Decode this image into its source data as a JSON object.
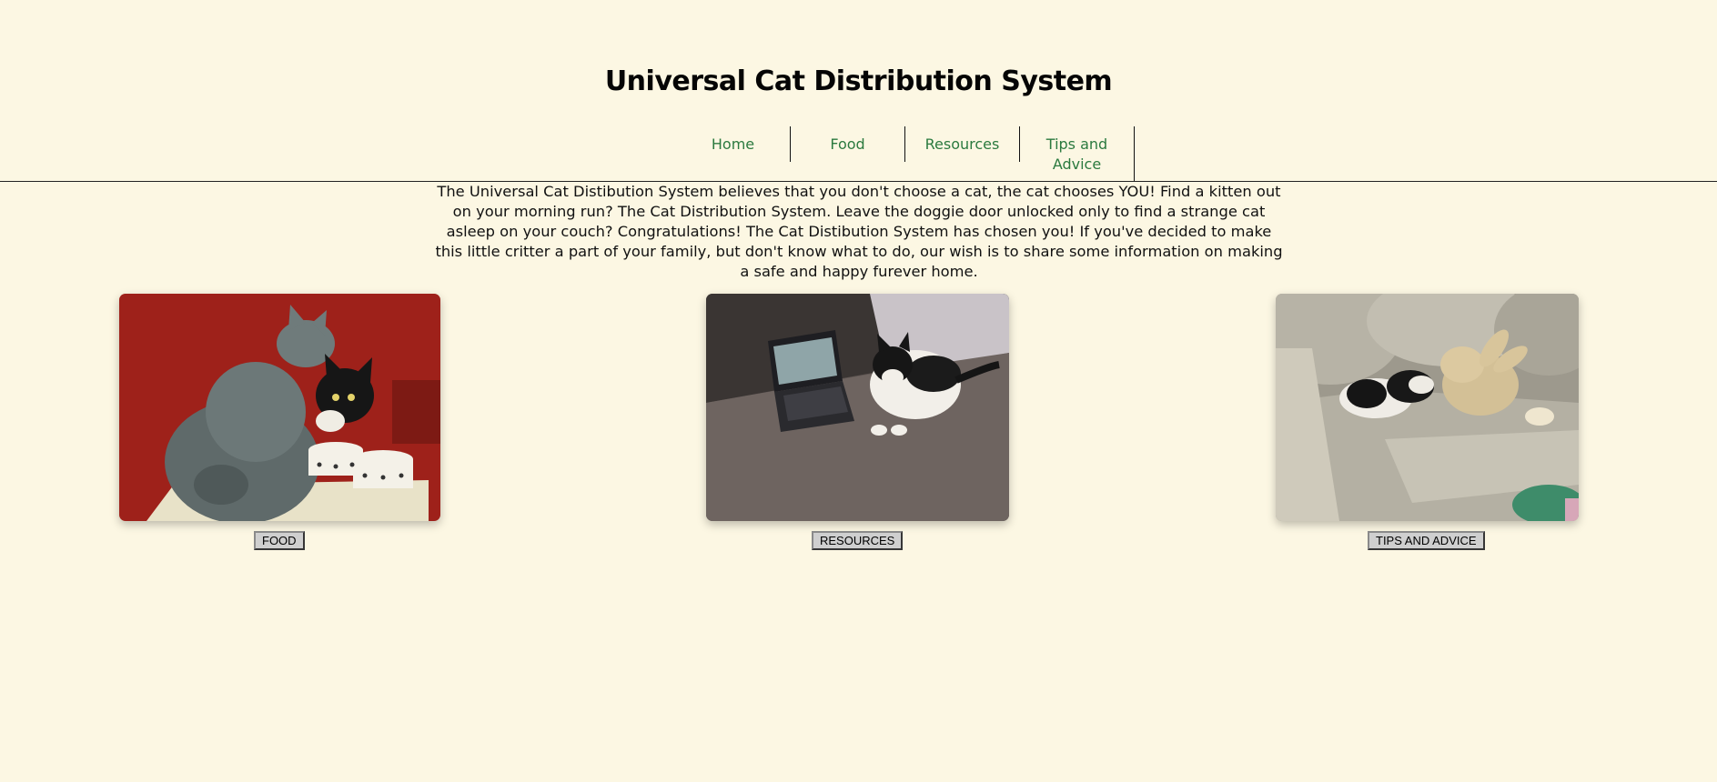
{
  "header": {
    "title": "Universal Cat Distribution System"
  },
  "nav": {
    "items": [
      {
        "label": "Home"
      },
      {
        "label": "Food"
      },
      {
        "label": "Resources"
      },
      {
        "label": "Tips and Advice"
      }
    ]
  },
  "main": {
    "intro": "The Universal Cat Distibution System believes that you don't choose a cat, the cat chooses YOU! Find a kitten out on your morning run? The Cat Distribution System. Leave the doggie door unlocked only to find a strange cat asleep on your couch? Congratulations! The Cat Distibution System has chosen you! If you've decided to make this little critter a part of your family, but don't know what to do, our wish is to share some information on making a safe and happy furever home."
  },
  "cards": [
    {
      "button_label": "FOOD",
      "photo": "two-cats-food-bowls-photo"
    },
    {
      "button_label": "RESOURCES",
      "photo": "cat-laptop-photo"
    },
    {
      "button_label": "TIPS AND ADVICE",
      "photo": "cats-couch-plush-photo"
    }
  ],
  "colors": {
    "background": "#fcf7e3",
    "nav_link": "#2b7a3f",
    "button_bg": "#cfcfcf"
  }
}
